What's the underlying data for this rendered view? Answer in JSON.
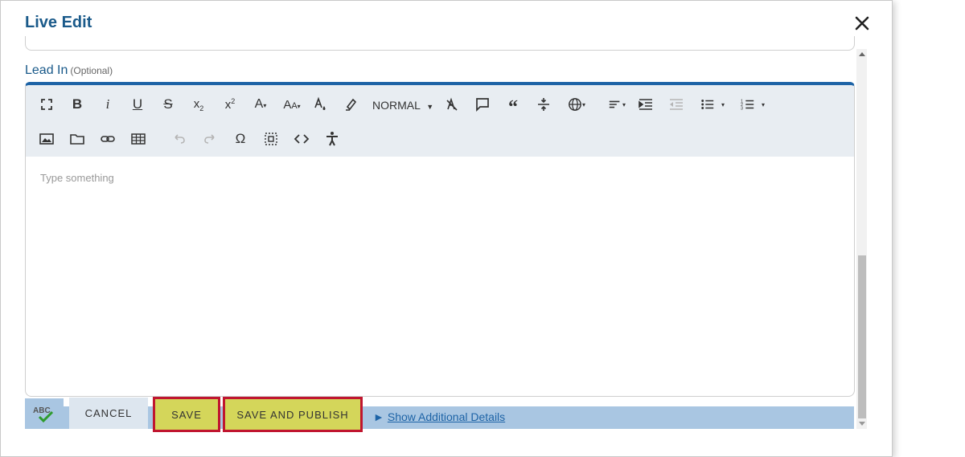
{
  "dialog": {
    "title": "Live Edit"
  },
  "field": {
    "label": "Lead In",
    "optional_label": "(Optional)"
  },
  "toolbar": {
    "format_label": "NORMAL",
    "row1": [
      "fullscreen-icon",
      "bold-icon",
      "italic-icon",
      "underline-icon",
      "strikethrough-icon",
      "subscript-icon",
      "superscript-icon",
      "font-color-icon",
      "font-size-icon",
      "text-color-drop-icon",
      "highlight-icon",
      "clear-format-icon",
      "comment-icon",
      "quote-icon",
      "line-height-icon",
      "language-icon",
      "align-icon",
      "indent-icon",
      "outdent-icon",
      "bullet-list-icon",
      "numbered-list-icon"
    ],
    "row2": [
      "image-icon",
      "folder-icon",
      "link-icon",
      "table-icon",
      "undo-icon",
      "redo-icon",
      "omega-icon",
      "select-all-icon",
      "code-view-icon",
      "accessibility-icon"
    ]
  },
  "editor": {
    "placeholder": "Type something"
  },
  "actions": {
    "spellcheck_label": "ABC",
    "cancel": "CANCEL",
    "save": "SAVE",
    "save_publish": "SAVE AND PUBLISH",
    "details_arrow": "►",
    "details": "Show Additional Details"
  },
  "colors": {
    "title": "#1a5a8a",
    "accent": "#1d63a6",
    "button": "#d4d65a",
    "highlight_border": "#c0152f",
    "bar": "#a9c6e2"
  }
}
